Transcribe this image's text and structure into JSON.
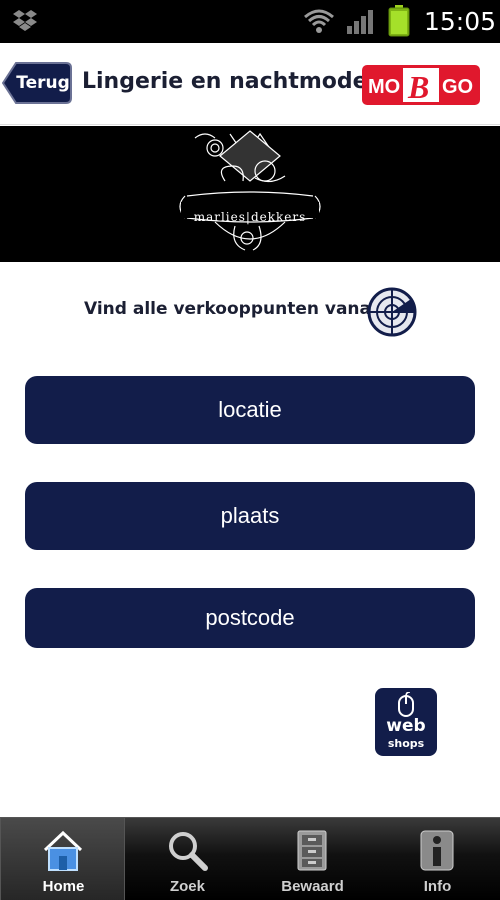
{
  "status_bar": {
    "time": "15:05",
    "icons": [
      "dropbox-icon",
      "wifi-icon",
      "signal-icon",
      "battery-icon"
    ]
  },
  "header": {
    "back_label": "Terug",
    "title": "Lingerie en nachtmode",
    "logo_text": "MOBGO"
  },
  "banner": {
    "brand_name": "marlies|dekkers"
  },
  "main": {
    "find_text": "Vind alle verkooppunten vanaf",
    "buttons": {
      "locatie": "locatie",
      "plaats": "plaats",
      "postcode": "postcode"
    },
    "webshops": {
      "line1": "web",
      "line2": "shops"
    }
  },
  "bottom_nav": {
    "items": [
      {
        "label": "Home",
        "icon": "home-icon",
        "active": true
      },
      {
        "label": "Zoek",
        "icon": "search-icon",
        "active": false
      },
      {
        "label": "Bewaard",
        "icon": "cabinet-icon",
        "active": false
      },
      {
        "label": "Info",
        "icon": "info-icon",
        "active": false
      }
    ]
  },
  "colors": {
    "navy": "#121d4a",
    "logo_red": "#e0182d"
  }
}
